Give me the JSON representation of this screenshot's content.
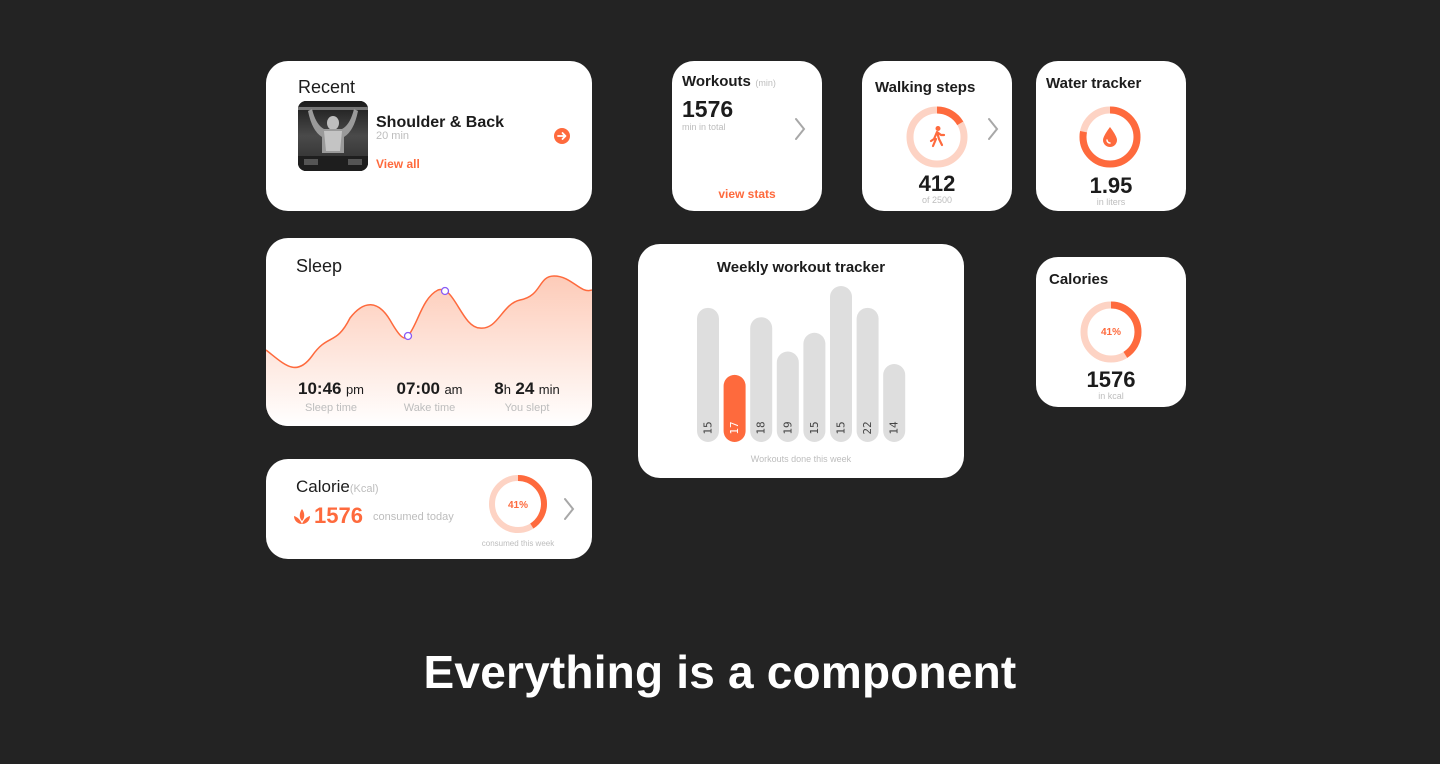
{
  "colors": {
    "accent": "#fe6a3d",
    "accent_light": "#fdd3c4",
    "bar_gray": "#dedede",
    "background": "#232323",
    "sleep_marker": "#8a5cf6"
  },
  "recent": {
    "title": "Recent",
    "workout_name": "Shoulder & Back",
    "duration": "20 min",
    "link": "View all"
  },
  "workouts": {
    "title": "Workouts",
    "unit": "(min)",
    "value": "1576",
    "caption": "min in total",
    "link": "view stats"
  },
  "walking": {
    "title": "Walking steps",
    "value": "412",
    "caption": "of 2500",
    "progress": 0.165,
    "icon": "walking-person-icon"
  },
  "water": {
    "title": "Water tracker",
    "value": "1.95",
    "caption": "in liters",
    "progress": 0.78,
    "icon": "water-drop-icon"
  },
  "sleep": {
    "title": "Sleep",
    "stats": [
      {
        "big": "10:46",
        "unit": "pm",
        "label": "Sleep time"
      },
      {
        "big": "07:00",
        "unit": "am",
        "label": "Wake time"
      },
      {
        "big": "8",
        "mid": "h",
        "big2": "24",
        "unit": "min",
        "label": "You slept"
      }
    ]
  },
  "weekly": {
    "title": "Weekly workout tracker",
    "caption": "Workouts done this week",
    "highlight_index": 1
  },
  "calories": {
    "title": "Calories",
    "percent_label": "41%",
    "value": "1576",
    "caption": "in kcal",
    "progress": 0.41
  },
  "calorie": {
    "title": "Calorie",
    "unit": "(Kcal)",
    "value": "1576",
    "caption": "consumed today",
    "percent_label": "41%",
    "week_caption": "consumed this week",
    "progress": 0.41,
    "icon": "flame-leaf-icon"
  },
  "headline": "Everything is a component",
  "chart_data": {
    "type": "bar",
    "title": "Weekly workout tracker",
    "xlabel": "Workouts done this week",
    "categories": [
      "1",
      "2",
      "3",
      "4",
      "5",
      "6",
      "7",
      "8"
    ],
    "values": [
      15,
      17,
      18,
      19,
      15,
      15,
      22,
      14
    ],
    "value_labels": [
      "15",
      "17",
      "18",
      "19",
      "15",
      "15",
      "22",
      "14"
    ],
    "bar_fill_fractions": [
      0.86,
      0.43,
      0.8,
      0.58,
      0.7,
      1.0,
      0.86,
      0.5
    ],
    "highlight_color": "#fe6a3d",
    "grid": false
  }
}
